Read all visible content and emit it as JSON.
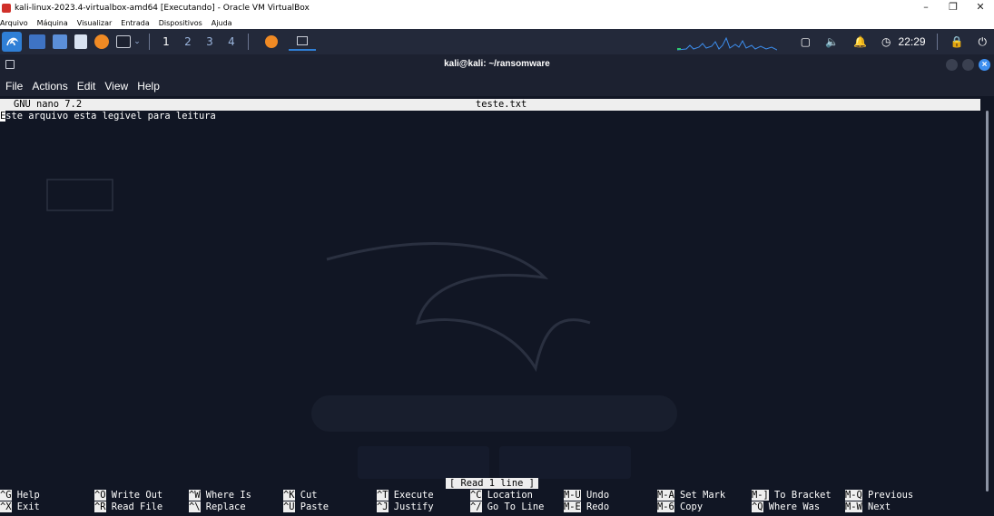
{
  "host": {
    "window_title": "kali-linux-2023.4-virtualbox-amd64 [Executando] - Oracle VM VirtualBox",
    "controls": [
      "–",
      "❐",
      "✕"
    ],
    "menu": [
      "Arquivo",
      "Máquina",
      "Visualizar",
      "Entrada",
      "Dispositivos",
      "Ajuda"
    ]
  },
  "panel": {
    "workspaces": [
      "1",
      "2",
      "3",
      "4"
    ],
    "clock": "22:29"
  },
  "terminal": {
    "title": "kali@kali: ~/ransomware",
    "menu": [
      "File",
      "Actions",
      "Edit",
      "View",
      "Help"
    ]
  },
  "nano": {
    "version": "GNU nano 7.2",
    "filename": "teste.txt",
    "line_cursor_char": "E",
    "line_rest": "ste arquivo esta legivel para leitura",
    "status": "[ Read 1 line ]",
    "shortcuts": [
      {
        "key": "^G",
        "label": "Help"
      },
      {
        "key": "^X",
        "label": "Exit"
      },
      {
        "key": "^O",
        "label": "Write Out"
      },
      {
        "key": "^R",
        "label": "Read File"
      },
      {
        "key": "^W",
        "label": "Where Is"
      },
      {
        "key": "^\\",
        "label": "Replace"
      },
      {
        "key": "^K",
        "label": "Cut"
      },
      {
        "key": "^U",
        "label": "Paste"
      },
      {
        "key": "^T",
        "label": "Execute"
      },
      {
        "key": "^J",
        "label": "Justify"
      },
      {
        "key": "^C",
        "label": "Location"
      },
      {
        "key": "^/",
        "label": "Go To Line"
      },
      {
        "key": "M-U",
        "label": "Undo"
      },
      {
        "key": "M-E",
        "label": "Redo"
      },
      {
        "key": "M-A",
        "label": "Set Mark"
      },
      {
        "key": "M-6",
        "label": "Copy"
      },
      {
        "key": "M-]",
        "label": "To Bracket"
      },
      {
        "key": "^Q",
        "label": "Where Was"
      },
      {
        "key": "M-Q",
        "label": "Previous"
      },
      {
        "key": "M-W",
        "label": "Next"
      }
    ]
  }
}
